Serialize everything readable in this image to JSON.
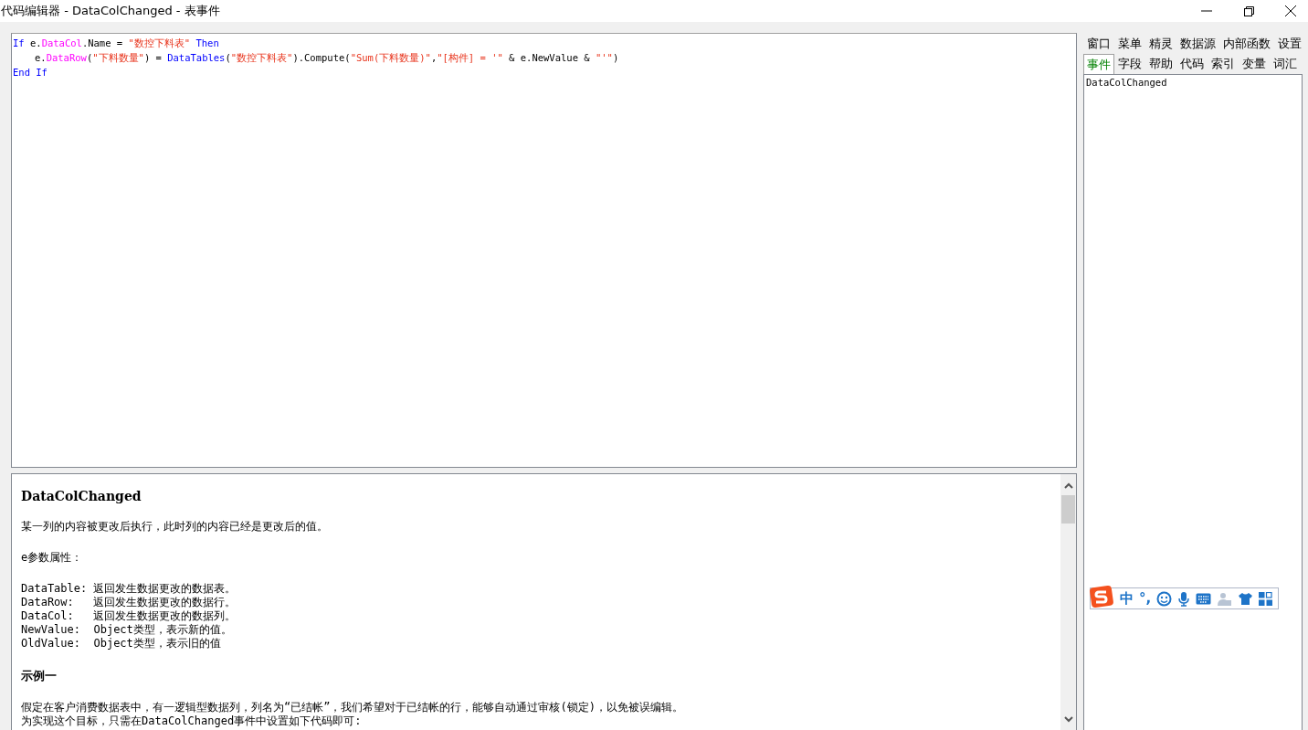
{
  "window": {
    "title": "代码编辑器 - DataColChanged - 表事件"
  },
  "editor": {
    "lines": [
      {
        "indented": false,
        "tokens": [
          {
            "kind": "keyword",
            "text": "If"
          },
          {
            "kind": "plain",
            "text": " e."
          },
          {
            "kind": "member",
            "text": "DataCol"
          },
          {
            "kind": "plain",
            "text": ".Name = "
          },
          {
            "kind": "string",
            "text": "\"数控下料表\""
          },
          {
            "kind": "keyword",
            "text": " Then"
          }
        ]
      },
      {
        "indented": true,
        "tokens": [
          {
            "kind": "plain",
            "text": "e."
          },
          {
            "kind": "member",
            "text": "DataRow"
          },
          {
            "kind": "plain",
            "text": "("
          },
          {
            "kind": "string",
            "text": "\"下料数量\""
          },
          {
            "kind": "plain",
            "text": ") = "
          },
          {
            "kind": "keyword",
            "text": "DataTables"
          },
          {
            "kind": "plain",
            "text": "("
          },
          {
            "kind": "string",
            "text": "\"数控下料表\""
          },
          {
            "kind": "plain",
            "text": ").Compute("
          },
          {
            "kind": "string",
            "text": "\"Sum(下料数量)\""
          },
          {
            "kind": "plain",
            "text": ","
          },
          {
            "kind": "string",
            "text": "\"[构件] = '\""
          },
          {
            "kind": "plain",
            "text": " & e.NewValue & "
          },
          {
            "kind": "string",
            "text": "\"'\""
          },
          {
            "kind": "plain",
            "text": ")"
          }
        ]
      },
      {
        "indented": false,
        "tokens": [
          {
            "kind": "keyword",
            "text": "End If"
          }
        ]
      }
    ]
  },
  "help": {
    "blocks": [
      {
        "kind": "title",
        "text": "DataColChanged"
      },
      {
        "kind": "paragraph",
        "text": "某一列的内容被更改后执行，此时列的内容已经是更改后的值。"
      },
      {
        "kind": "paragraph",
        "text": "e参数属性："
      },
      {
        "kind": "lines",
        "lines": [
          "DataTable: 返回发生数据更改的数据表。",
          "DataRow:   返回发生数据更改的数据行。",
          "DataCol:   返回发生数据更改的数据列。",
          "NewValue:  Object类型，表示新的值。",
          "OldValue:  Object类型，表示旧的值"
        ]
      },
      {
        "kind": "heading",
        "text": "示例一"
      },
      {
        "kind": "lines",
        "lines": [
          "假定在客户消费数据表中，有一逻辑型数据列，列名为“已结帐”，我们希望对于已结帐的行，能够自动通过审核(锁定)，以免被误编辑。",
          "为实现这个目标，只需在DataColChanged事件中设置如下代码即可:"
        ]
      }
    ]
  },
  "side_tabs": [
    [
      {
        "label": "窗口",
        "selected": false
      },
      {
        "label": "菜单",
        "selected": false
      },
      {
        "label": "精灵",
        "selected": false
      },
      {
        "label": "数据源",
        "selected": false
      },
      {
        "label": "内部函数",
        "selected": false
      },
      {
        "label": "设置",
        "selected": false
      }
    ],
    [
      {
        "label": "事件",
        "selected": true
      },
      {
        "label": "字段",
        "selected": false
      },
      {
        "label": "帮助",
        "selected": false
      },
      {
        "label": "代码",
        "selected": false
      },
      {
        "label": "索引",
        "selected": false
      },
      {
        "label": "变量",
        "selected": false
      },
      {
        "label": "词汇",
        "selected": false
      }
    ]
  ],
  "side_list": {
    "items": [
      "DataColChanged"
    ]
  },
  "ime_toolbar": {
    "mode": "中",
    "punctuation": "°,"
  }
}
